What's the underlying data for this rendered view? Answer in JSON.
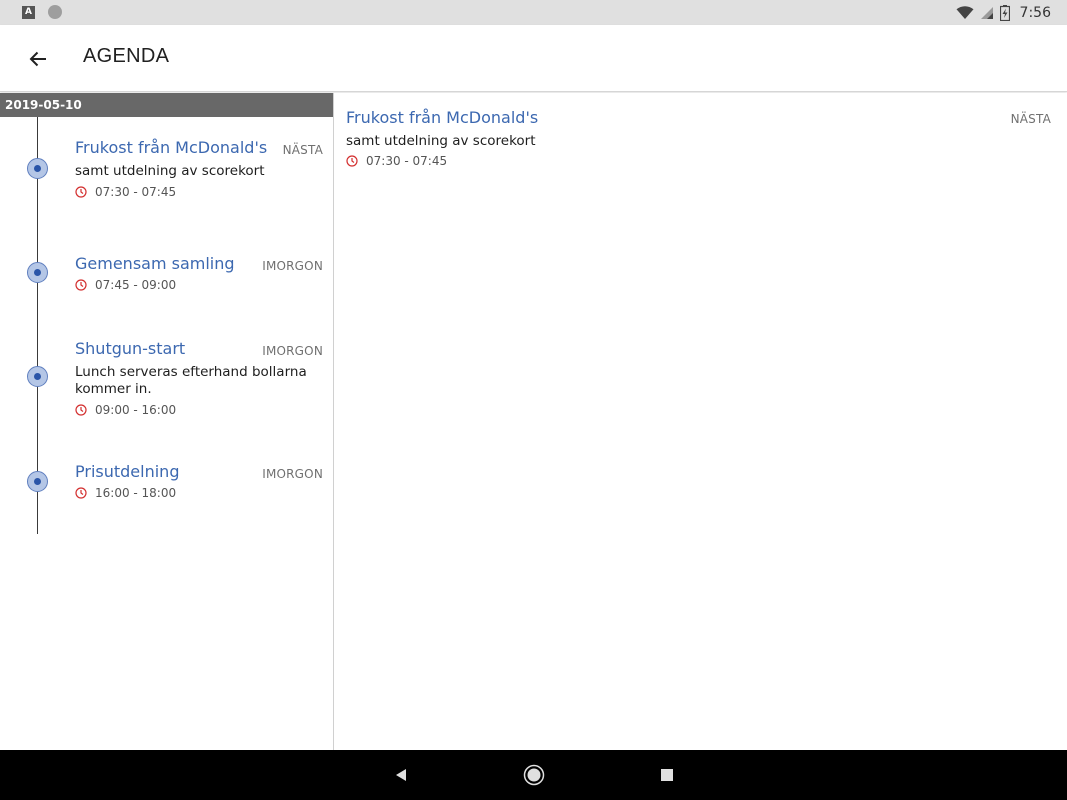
{
  "status_bar": {
    "app_icon_letter": "A",
    "time": "7:56"
  },
  "app_bar": {
    "title": "AGENDA"
  },
  "agenda": {
    "date": "2019-05-10",
    "events": [
      {
        "title": "Frukost från McDonald's",
        "badge": "NÄSTA",
        "description": "samt utdelning av scorekort",
        "time": "07:30 - 07:45"
      },
      {
        "title": "Gemensam samling",
        "badge": "IMORGON",
        "description": "",
        "time": "07:45 - 09:00"
      },
      {
        "title": "Shutgun-start",
        "badge": "IMORGON",
        "description": "Lunch serveras efterhand bollarna kommer in.",
        "time": "09:00 - 16:00"
      },
      {
        "title": "Prisutdelning",
        "badge": "IMORGON",
        "description": "",
        "time": "16:00 - 18:00"
      }
    ]
  },
  "detail": {
    "title": "Frukost från McDonald's",
    "badge": "NÄSTA",
    "description": "samt utdelning av scorekort",
    "time": "07:30 - 07:45"
  },
  "colors": {
    "accent": "#3c68b0",
    "clock": "#d32f2f",
    "date_header_bg": "#686868"
  },
  "icons": {
    "back": "arrow-left-icon",
    "clock": "clock-icon",
    "wifi": "wifi-icon",
    "signal": "cell-signal-icon",
    "battery": "battery-charging-icon",
    "nav_back": "triangle-back-icon",
    "nav_home": "circle-home-icon",
    "nav_recents": "square-recents-icon"
  }
}
